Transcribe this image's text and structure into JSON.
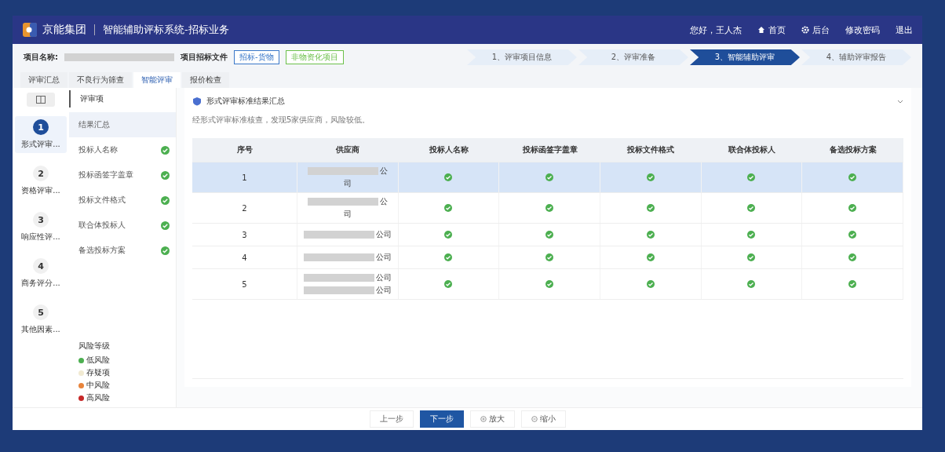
{
  "header": {
    "logo": "京能集团",
    "title": "智能辅助评标系统-招标业务",
    "greeting": "您好，王人杰",
    "links": [
      {
        "kind": "home",
        "label": "首页"
      },
      {
        "kind": "gear",
        "label": "后台"
      },
      {
        "kind": "plain",
        "label": "修改密码"
      },
      {
        "kind": "plain",
        "label": "退出"
      }
    ]
  },
  "project": {
    "label": "项目名称:",
    "file_label": "项目招标文件",
    "tags": [
      {
        "label": "招标-货物",
        "color": "#3a78c9"
      },
      {
        "label": "非物资化项目",
        "color": "#6cc04a"
      }
    ]
  },
  "steps": [
    {
      "label": "1、评审项目信息",
      "selected": false
    },
    {
      "label": "2、评审准备",
      "selected": false
    },
    {
      "label": "3、智能辅助评审",
      "selected": true
    },
    {
      "label": "4、辅助评审报告",
      "selected": false
    }
  ],
  "tabs": [
    {
      "label": "评审汇总",
      "selected": false
    },
    {
      "label": "不良行为筛查",
      "selected": false
    },
    {
      "label": "智能评审",
      "selected": true
    },
    {
      "label": "报价检查",
      "selected": false
    }
  ],
  "stages": [
    {
      "number": "1",
      "label": "形式评审...",
      "selected": true
    },
    {
      "number": "2",
      "label": "资格评审...",
      "selected": false
    },
    {
      "number": "3",
      "label": "响应性评...",
      "selected": false
    },
    {
      "number": "4",
      "label": "商务评分...",
      "selected": false
    },
    {
      "number": "5",
      "label": "其他因素...",
      "selected": false
    }
  ],
  "items_title": "评审项",
  "items": [
    {
      "label": "结果汇总",
      "selected": true
    },
    {
      "label": "投标人名称",
      "selected": false,
      "passed": true
    },
    {
      "label": "投标函签字盖章",
      "selected": false,
      "passed": true
    },
    {
      "label": "投标文件格式",
      "selected": false,
      "passed": true
    },
    {
      "label": "联合体投标人",
      "selected": false,
      "passed": true
    },
    {
      "label": "备选投标方案",
      "selected": false,
      "passed": true
    }
  ],
  "risk": {
    "title": "风险等级",
    "levels": [
      {
        "label": "低风险",
        "color": "#4caf50"
      },
      {
        "label": "存疑项",
        "color": "#f1ead2"
      },
      {
        "label": "中风险",
        "color": "#e8843c"
      },
      {
        "label": "高风险",
        "color": "#c62828"
      }
    ]
  },
  "section": {
    "title": "形式评审标准结果汇总",
    "summary": "经形式评审标准核查，发现5家供应商，风险较低。"
  },
  "table": {
    "columns": [
      "序号",
      "供应商",
      "投标人名称",
      "投标函签字盖章",
      "投标文件格式",
      "联合体投标人",
      "备选投标方案"
    ],
    "rows": [
      {
        "no": "1",
        "selected": true,
        "supplier": [
          {
            "redacted": true,
            "text": "公"
          },
          {
            "redacted": false,
            "text": "司"
          }
        ],
        "checks": [
          true,
          true,
          true,
          true,
          true
        ]
      },
      {
        "no": "2",
        "selected": false,
        "supplier": [
          {
            "redacted": true,
            "text": "公"
          },
          {
            "redacted": false,
            "text": "司"
          }
        ],
        "checks": [
          true,
          true,
          true,
          true,
          true
        ]
      },
      {
        "no": "3",
        "selected": false,
        "supplier": [
          {
            "redacted": true,
            "text": "公司"
          }
        ],
        "checks": [
          true,
          true,
          true,
          true,
          true
        ]
      },
      {
        "no": "4",
        "selected": false,
        "supplier": [
          {
            "redacted": true,
            "text": "公司"
          }
        ],
        "checks": [
          true,
          true,
          true,
          true,
          true
        ]
      },
      {
        "no": "5",
        "selected": false,
        "supplier": [
          {
            "redacted": true,
            "text": "公司"
          },
          {
            "redacted": true,
            "text": "公司"
          }
        ],
        "checks": [
          true,
          true,
          true,
          true,
          true
        ]
      }
    ]
  },
  "footer": [
    {
      "kind": "plain",
      "label": "上一步"
    },
    {
      "kind": "primary",
      "label": "下一步"
    },
    {
      "kind": "zoom-in",
      "label": "放大"
    },
    {
      "kind": "zoom-out",
      "label": "缩小"
    }
  ]
}
